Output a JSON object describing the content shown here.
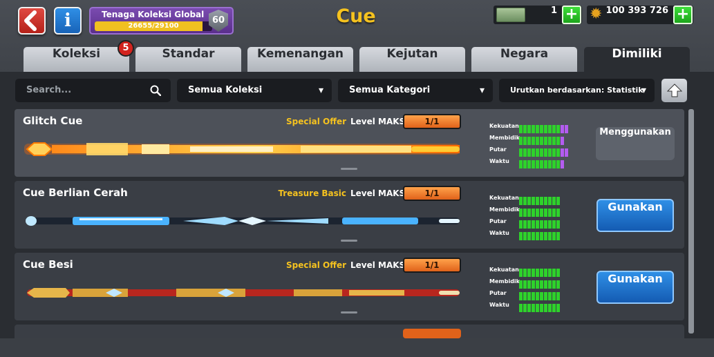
{
  "header": {
    "title": "Cue",
    "progress": {
      "label": "Tenaga Koleksi Global",
      "value_text": "26655/29100",
      "current": 26655,
      "max": 29100,
      "level": "60"
    },
    "cash": {
      "amount": "1"
    },
    "coins": {
      "amount": "100 393 726"
    }
  },
  "tabs": [
    {
      "label": "Koleksi",
      "badge": "5"
    },
    {
      "label": "Standar"
    },
    {
      "label": "Kemenangan"
    },
    {
      "label": "Kejutan"
    },
    {
      "label": "Negara"
    },
    {
      "label": "Dimiliki",
      "active": true
    }
  ],
  "filters": {
    "search_placeholder": "Search...",
    "collection": "Semua Koleksi",
    "category": "Semua Kategori",
    "sort": "Urutkan berdasarkan: Statistik"
  },
  "stat_labels": [
    "Kekuatan",
    "Membidik",
    "Putar",
    "Waktu"
  ],
  "cues": [
    {
      "name": "Glitch Cue",
      "offer": "Special Offer",
      "level": "Level MAKS",
      "count": "1/1",
      "button": "Menggunakan",
      "in_use": true,
      "stats": [
        [
          10,
          2
        ],
        [
          10,
          1
        ],
        [
          10,
          2
        ],
        [
          10,
          1
        ]
      ]
    },
    {
      "name": "Cue Berlian Cerah",
      "offer": "Treasure Basic",
      "level": "Level MAKS",
      "count": "1/1",
      "button": "Gunakan",
      "in_use": false,
      "stats": [
        [
          10,
          0
        ],
        [
          10,
          0
        ],
        [
          10,
          0
        ],
        [
          10,
          0
        ]
      ]
    },
    {
      "name": "Cue Besi",
      "offer": "Special Offer",
      "level": "Level MAKS",
      "count": "1/1",
      "button": "Gunakan",
      "in_use": false,
      "stats": [
        [
          10,
          0
        ],
        [
          10,
          0
        ],
        [
          10,
          0
        ],
        [
          10,
          0
        ]
      ]
    }
  ],
  "colors": {
    "accent": "#f5c21f",
    "bar_green": "#2ed22b",
    "bar_purple": "#b45cf0",
    "button_blue": "#1f75d0",
    "count_orange": "#f07a2a"
  }
}
